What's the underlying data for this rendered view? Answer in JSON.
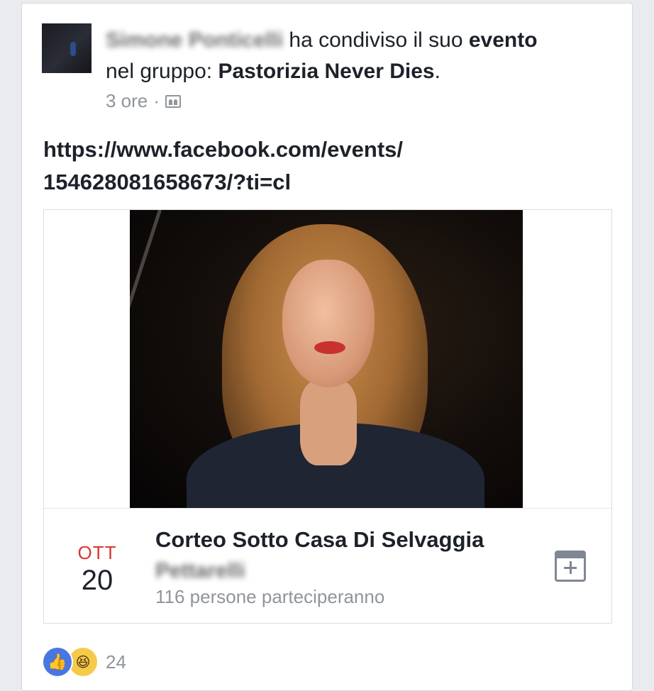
{
  "post": {
    "author_name": "Simone Ponticelli",
    "action_text": " ha condiviso il suo ",
    "event_word": "evento",
    "group_prefix": "nel gruppo: ",
    "group_name": "Pastorizia Never Dies",
    "group_suffix": ".",
    "time": "3 ore",
    "separator": "·",
    "audience_icon": "group-icon",
    "link_line1": "https://www.facebook.com/events/",
    "link_line2": "154628081658673/?ti=cl"
  },
  "event": {
    "month": "OTT",
    "day": "20",
    "title": "Corteo Sotto Casa Di Selvaggia",
    "title_line2": "Pettarelli",
    "attendance": "116 persone parteciperanno",
    "save_icon": "calendar-add-icon"
  },
  "reactions": {
    "types": [
      "like-icon",
      "haha-icon"
    ],
    "count": "24",
    "like_color": "#4a76e2",
    "haha_color": "#f7c948"
  },
  "colors": {
    "date_month": "#d8382f",
    "meta_text": "#90949c"
  }
}
